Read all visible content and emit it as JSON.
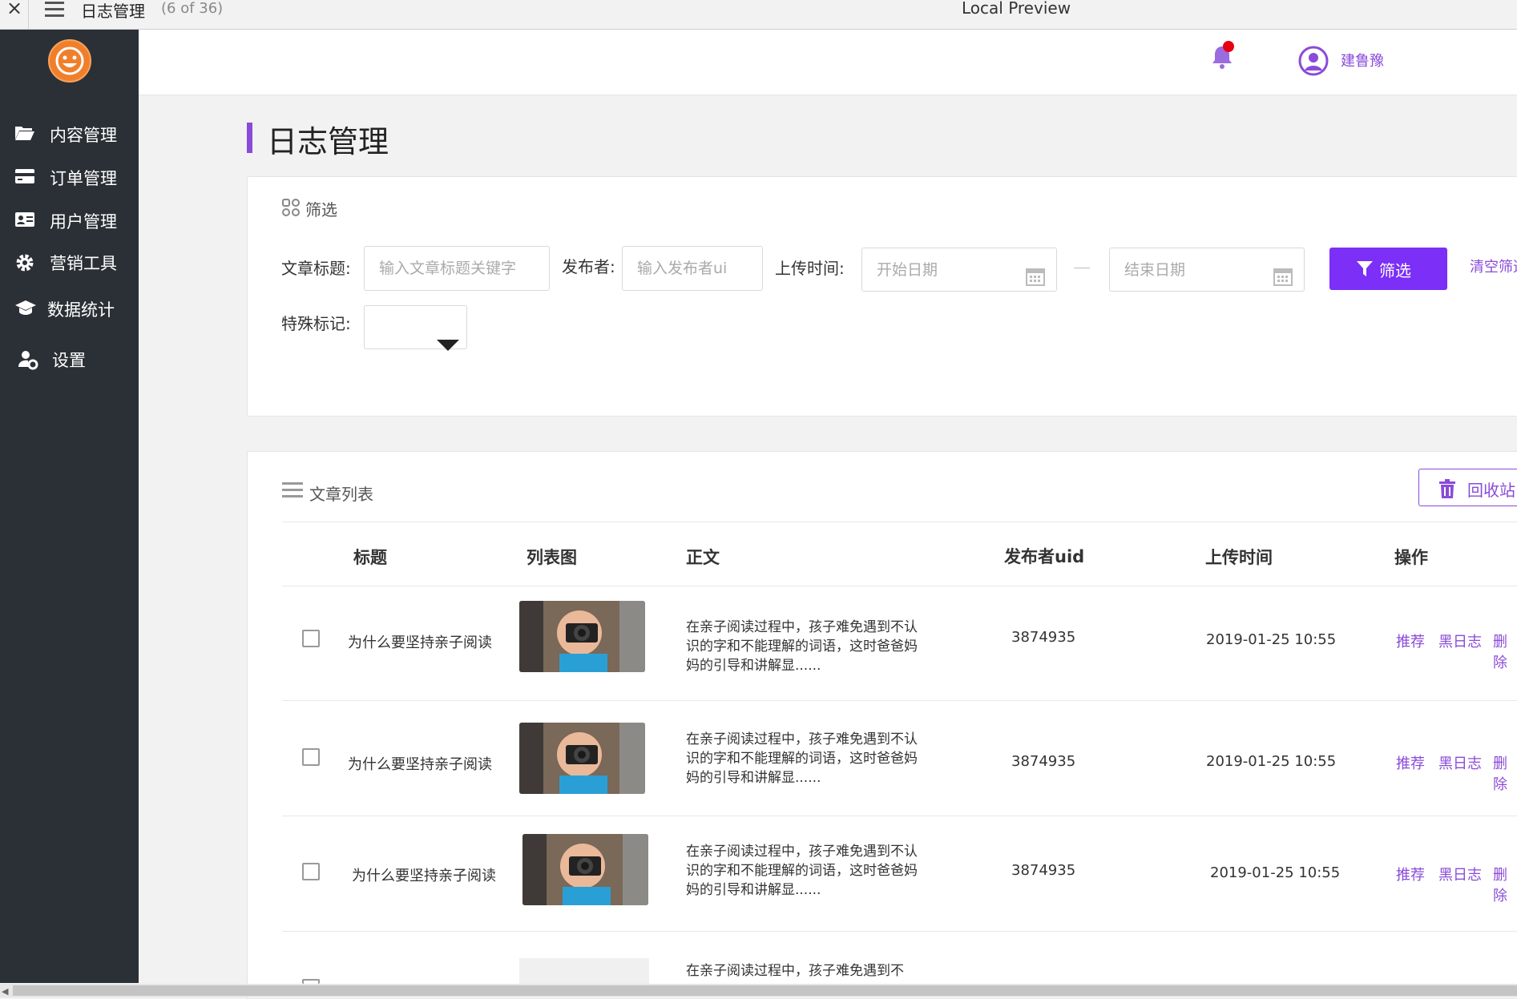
{
  "window": {
    "title": "日志管理",
    "count": "(6 of 36)",
    "preview_label": "Local Preview"
  },
  "sidebar": {
    "items": [
      {
        "label": "内容管理",
        "icon": "folder-open-icon"
      },
      {
        "label": "订单管理",
        "icon": "credit-card-icon"
      },
      {
        "label": "用户管理",
        "icon": "id-card-icon"
      },
      {
        "label": "营销工具",
        "icon": "gear-icon"
      },
      {
        "label": "数据统计",
        "icon": "graduation-cap-icon"
      },
      {
        "label": "设置",
        "icon": "user-settings-icon"
      }
    ]
  },
  "header": {
    "username": "建鲁豫"
  },
  "page": {
    "title": "日志管理"
  },
  "filter": {
    "section_title": "筛选",
    "title_label": "文章标题:",
    "title_placeholder": "输入文章标题关键字",
    "publisher_label": "发布者:",
    "publisher_placeholder": "输入发布者ui",
    "upload_label": "上传时间:",
    "start_placeholder": "开始日期",
    "end_placeholder": "结束日期",
    "mark_label": "特殊标记:",
    "mark_value": "",
    "filter_button": "筛选",
    "clear_button": "清空筛选"
  },
  "list": {
    "section_title": "文章列表",
    "recycle_button": "回收站",
    "columns": [
      "标题",
      "列表图",
      "正文",
      "发布者uid",
      "上传时间",
      "操作"
    ],
    "rows": [
      {
        "title": "为什么要坚持亲子阅读",
        "body": "在亲子阅读过程中，孩子难免遇到不认识的字和不能理解的词语，这时爸爸妈妈的引导和讲解显......",
        "uid": "3874935",
        "time": "2019-01-25 10:55",
        "ops": [
          "推荐",
          "黑日志",
          "删除"
        ]
      },
      {
        "title": "为什么要坚持亲子阅读",
        "body": "在亲子阅读过程中，孩子难免遇到不认识的字和不能理解的词语，这时爸爸妈妈的引导和讲解显......",
        "uid": "3874935",
        "time": "2019-01-25 10:55",
        "ops": [
          "推荐",
          "黑日志",
          "删除"
        ]
      },
      {
        "title": "为什么要坚持亲子阅读",
        "body": "在亲子阅读过程中，孩子难免遇到不认识的字和不能理解的词语，这时爸爸妈妈的引导和讲解显......",
        "uid": "3874935",
        "time": "2019-01-25 10:55",
        "ops": [
          "推荐",
          "黑日志",
          "删除"
        ]
      },
      {
        "title": "",
        "body": "在亲子阅读过程中，孩子难免遇到不",
        "uid": "",
        "time": "",
        "ops": []
      }
    ]
  },
  "colors": {
    "accent": "#8a4bd8",
    "primary_button": "#7b2ff7",
    "sidebar_bg": "#2b3036",
    "notification_dot": "#e60012",
    "logo": "#f07f2c"
  }
}
